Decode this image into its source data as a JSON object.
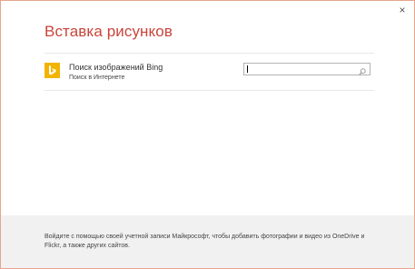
{
  "dialog": {
    "title": "Вставка рисунков",
    "close_glyph": "×"
  },
  "sources": [
    {
      "icon": "bing-logo-icon",
      "name": "Поиск изображений Bing",
      "subtitle": "Поиск в Интернете",
      "search": {
        "value": "",
        "placeholder": ""
      }
    }
  ],
  "footer": {
    "message": "Войдите с помощью своей учетной записи Майкрософт, чтобы добавить фотографии и видео из OneDrive и Flickr, а также других сайтов."
  },
  "colors": {
    "accent": "#c9443a",
    "bing_yellow": "#f2b400",
    "border": "#e7a58e",
    "footer_bg": "#f1f1f1"
  }
}
